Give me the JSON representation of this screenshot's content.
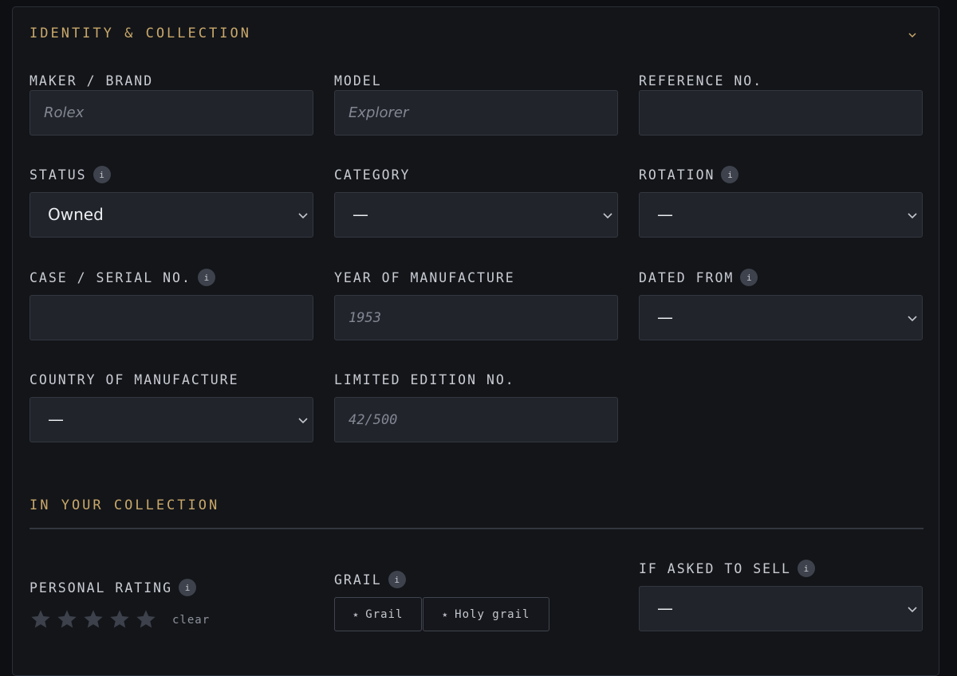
{
  "identity": {
    "title": "IDENTITY & COLLECTION",
    "maker": {
      "label": "MAKER / BRAND",
      "placeholder": "Rolex",
      "value": ""
    },
    "model": {
      "label": "MODEL",
      "placeholder": "Explorer",
      "value": ""
    },
    "reference": {
      "label": "REFERENCE NO.",
      "placeholder": "",
      "value": ""
    },
    "status": {
      "label": "STATUS",
      "value": "Owned"
    },
    "category": {
      "label": "CATEGORY",
      "value": "—"
    },
    "rotation": {
      "label": "ROTATION",
      "value": "—"
    },
    "serial": {
      "label": "CASE / SERIAL NO.",
      "placeholder": "",
      "value": ""
    },
    "year": {
      "label": "YEAR OF MANUFACTURE",
      "placeholder": "1953",
      "value": ""
    },
    "dated_from": {
      "label": "DATED FROM",
      "value": "—"
    },
    "country": {
      "label": "COUNTRY OF MANUFACTURE",
      "value": "—"
    },
    "limited": {
      "label": "LIMITED EDITION NO.",
      "placeholder": "42/500",
      "value": ""
    }
  },
  "collection": {
    "title": "IN YOUR COLLECTION",
    "rating": {
      "label": "PERSONAL RATING",
      "value": 0,
      "max": 5,
      "clear_label": "clear"
    },
    "grail": {
      "label": "GRAIL",
      "options": [
        "Grail",
        "Holy grail"
      ]
    },
    "sell": {
      "label": "IF ASKED TO SELL",
      "value": "—"
    }
  },
  "info_glyph": "i",
  "icons": {
    "info": "info-icon",
    "chevron": "chevron-down-icon",
    "star": "star-icon"
  },
  "colors": {
    "accent": "#c9a86a",
    "background": "#131519",
    "field": "#21242b",
    "border": "#33373f",
    "star_empty": "#3d414b"
  }
}
